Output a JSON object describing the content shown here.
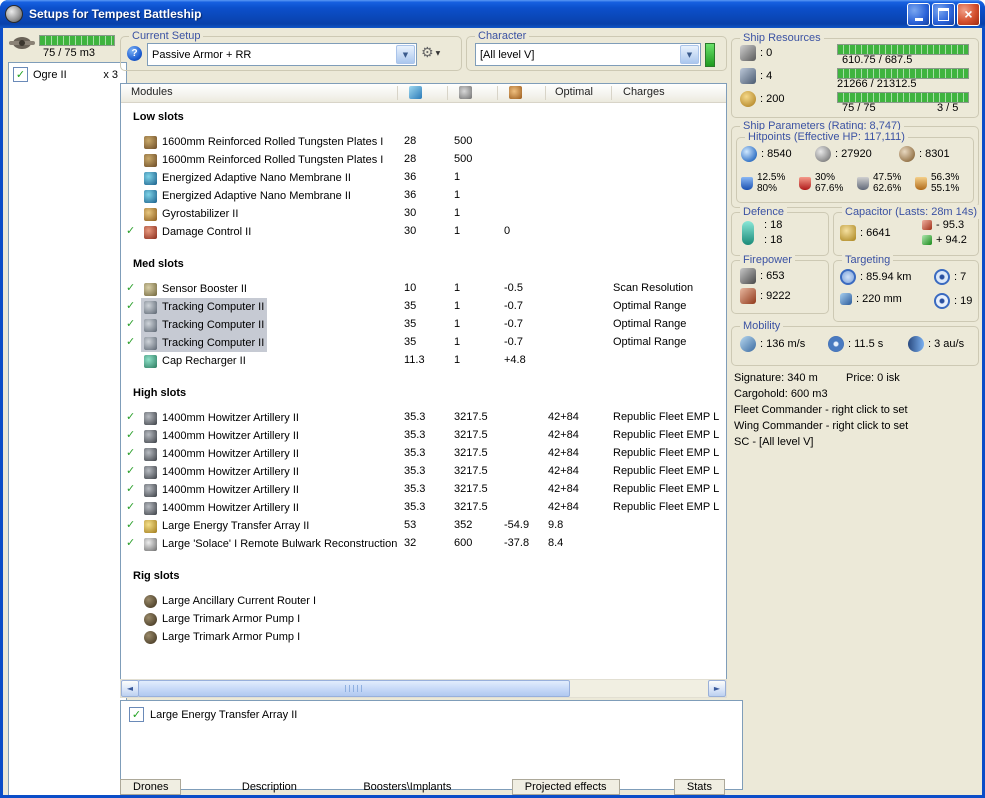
{
  "window": {
    "title": "Setups for Tempest Battleship"
  },
  "left_panel": {
    "drone_bay_capacity": "75 / 75 m3",
    "drones": [
      {
        "checked": true,
        "name": "Ogre II",
        "qty": "x 3"
      }
    ]
  },
  "setup_bar": {
    "current_setup_label": "Current Setup",
    "current_setup_value": "Passive Armor + RR",
    "character_label": "Character",
    "character_value": "[All level V]"
  },
  "modules": {
    "header": {
      "name": "Modules",
      "optimal": "Optimal",
      "charges": "Charges",
      "icons": [
        "cpu-icon",
        "powergrid-icon",
        "capacitor-icon"
      ]
    },
    "sections": [
      {
        "name": "Low slots",
        "rows": [
          {
            "active": false,
            "selected": false,
            "icon": "armor-plate-icon",
            "name": "1600mm Reinforced Rolled Tungsten Plates I",
            "cpu": "28",
            "pg": "500",
            "cap": "",
            "optimal": "",
            "charges": ""
          },
          {
            "active": false,
            "selected": false,
            "icon": "armor-plate-icon",
            "name": "1600mm Reinforced Rolled Tungsten Plates I",
            "cpu": "28",
            "pg": "500",
            "cap": "",
            "optimal": "",
            "charges": ""
          },
          {
            "active": false,
            "selected": false,
            "icon": "nano-membrane-icon",
            "name": "Energized Adaptive Nano Membrane II",
            "cpu": "36",
            "pg": "1",
            "cap": "",
            "optimal": "",
            "charges": ""
          },
          {
            "active": false,
            "selected": false,
            "icon": "nano-membrane-icon",
            "name": "Energized Adaptive Nano Membrane II",
            "cpu": "36",
            "pg": "1",
            "cap": "",
            "optimal": "",
            "charges": ""
          },
          {
            "active": false,
            "selected": false,
            "icon": "gyrostabilizer-icon",
            "name": "Gyrostabilizer II",
            "cpu": "30",
            "pg": "1",
            "cap": "",
            "optimal": "",
            "charges": ""
          },
          {
            "active": true,
            "selected": false,
            "icon": "damage-control-icon",
            "name": "Damage Control II",
            "cpu": "30",
            "pg": "1",
            "cap": "0",
            "optimal": "",
            "charges": ""
          }
        ]
      },
      {
        "name": "Med slots",
        "rows": [
          {
            "active": true,
            "selected": false,
            "icon": "sensor-booster-icon",
            "name": "Sensor Booster II",
            "cpu": "10",
            "pg": "1",
            "cap": "-0.5",
            "optimal": "",
            "charges": "Scan Resolution"
          },
          {
            "active": true,
            "selected": true,
            "icon": "tracking-computer-icon",
            "name": "Tracking Computer II",
            "cpu": "35",
            "pg": "1",
            "cap": "-0.7",
            "optimal": "",
            "charges": "Optimal Range"
          },
          {
            "active": true,
            "selected": true,
            "icon": "tracking-computer-icon",
            "name": "Tracking Computer II",
            "cpu": "35",
            "pg": "1",
            "cap": "-0.7",
            "optimal": "",
            "charges": "Optimal Range"
          },
          {
            "active": true,
            "selected": true,
            "icon": "tracking-computer-icon",
            "name": "Tracking Computer II",
            "cpu": "35",
            "pg": "1",
            "cap": "-0.7",
            "optimal": "",
            "charges": "Optimal Range"
          },
          {
            "active": false,
            "selected": false,
            "icon": "cap-recharger-icon",
            "name": "Cap Recharger II",
            "cpu": "11.3",
            "pg": "1",
            "cap": "+4.8",
            "optimal": "",
            "charges": ""
          }
        ]
      },
      {
        "name": "High slots",
        "rows": [
          {
            "active": true,
            "selected": false,
            "icon": "artillery-icon",
            "name": "1400mm Howitzer Artillery II",
            "cpu": "35.3",
            "pg": "3217.5",
            "cap": "",
            "optimal": "42+84",
            "charges": "Republic Fleet EMP L"
          },
          {
            "active": true,
            "selected": false,
            "icon": "artillery-icon",
            "name": "1400mm Howitzer Artillery II",
            "cpu": "35.3",
            "pg": "3217.5",
            "cap": "",
            "optimal": "42+84",
            "charges": "Republic Fleet EMP L"
          },
          {
            "active": true,
            "selected": false,
            "icon": "artillery-icon",
            "name": "1400mm Howitzer Artillery II",
            "cpu": "35.3",
            "pg": "3217.5",
            "cap": "",
            "optimal": "42+84",
            "charges": "Republic Fleet EMP L"
          },
          {
            "active": true,
            "selected": false,
            "icon": "artillery-icon",
            "name": "1400mm Howitzer Artillery II",
            "cpu": "35.3",
            "pg": "3217.5",
            "cap": "",
            "optimal": "42+84",
            "charges": "Republic Fleet EMP L"
          },
          {
            "active": true,
            "selected": false,
            "icon": "artillery-icon",
            "name": "1400mm Howitzer Artillery II",
            "cpu": "35.3",
            "pg": "3217.5",
            "cap": "",
            "optimal": "42+84",
            "charges": "Republic Fleet EMP L"
          },
          {
            "active": true,
            "selected": false,
            "icon": "artillery-icon",
            "name": "1400mm Howitzer Artillery II",
            "cpu": "35.3",
            "pg": "3217.5",
            "cap": "",
            "optimal": "42+84",
            "charges": "Republic Fleet EMP L"
          },
          {
            "active": true,
            "selected": false,
            "icon": "energy-transfer-icon",
            "name": "Large Energy Transfer Array II",
            "cpu": "53",
            "pg": "352",
            "cap": "-54.9",
            "optimal": "9.8",
            "charges": ""
          },
          {
            "active": true,
            "selected": false,
            "icon": "remote-repairer-icon",
            "name": "Large 'Solace' I Remote Bulwark Reconstruction",
            "cpu": "32",
            "pg": "600",
            "cap": "-37.8",
            "optimal": "8.4",
            "charges": ""
          }
        ]
      },
      {
        "name": "Rig slots",
        "rows": [
          {
            "active": false,
            "selected": false,
            "icon": "rig-icon",
            "name": "Large Ancillary Current Router I",
            "cpu": "",
            "pg": "",
            "cap": "",
            "optimal": "",
            "charges": ""
          },
          {
            "active": false,
            "selected": false,
            "icon": "rig-icon",
            "name": "Large Trimark Armor Pump I",
            "cpu": "",
            "pg": "",
            "cap": "",
            "optimal": "",
            "charges": ""
          },
          {
            "active": false,
            "selected": false,
            "icon": "rig-icon",
            "name": "Large Trimark Armor Pump I",
            "cpu": "",
            "pg": "",
            "cap": "",
            "optimal": "",
            "charges": ""
          }
        ]
      }
    ]
  },
  "charges_panel": {
    "items": [
      {
        "checked": true,
        "name": "Large Energy Transfer Array II"
      }
    ]
  },
  "bottom_tabs": [
    {
      "label": "Drones"
    },
    {
      "label": "Description"
    },
    {
      "label": "Boosters\\Implants"
    },
    {
      "label": "Projected effects"
    },
    {
      "label": "Stats"
    }
  ],
  "ship_resources": {
    "title": "Ship Resources",
    "turrets": ": 0",
    "launchers": ": 4",
    "calibration": ": 200",
    "cpu_usage": "610.75 / 687.5",
    "powergrid_usage": "21266 / 21312.5",
    "dronebay_usage": "75 / 75",
    "drones_active": "3 / 5"
  },
  "ship_parameters": {
    "title": "Ship Parameters (Rating: 8,747)",
    "hitpoints_title": "Hitpoints (Effective HP: 117,111)",
    "shield_hp": ": 8540",
    "armor_hp": ": 27920",
    "structure_hp": ": 8301",
    "resists": [
      {
        "icon": "em-resist-icon",
        "shield": "12.5%",
        "armor": "80%"
      },
      {
        "icon": "thermal-resist-icon",
        "shield": "30%",
        "armor": "67.6%"
      },
      {
        "icon": "kinetic-resist-icon",
        "shield": "47.5%",
        "armor": "62.6%"
      },
      {
        "icon": "explosive-resist-icon",
        "shield": "56.3%",
        "armor": "55.1%"
      }
    ]
  },
  "defence": {
    "title": "Defence",
    "value1": ": 18",
    "value2": ": 18"
  },
  "capacitor": {
    "title": "Capacitor (Lasts: 28m 14s)",
    "amount": ": 6641",
    "drain": "- 95.3",
    "recharge": "+ 94.2"
  },
  "firepower": {
    "title": "Firepower",
    "dps": ": 653",
    "volley": ": 9222"
  },
  "targeting": {
    "title": "Targeting",
    "range": ": 85.94 km",
    "max_targets": ": 7",
    "scan_resolution": ": 220 mm",
    "sensor_strength": ": 19"
  },
  "mobility": {
    "title": "Mobility",
    "speed": ": 136 m/s",
    "align_time": ": 11.5 s",
    "warp_speed": ": 3 au/s"
  },
  "info": {
    "signature": "Signature: 340 m",
    "price": "Price: 0 isk",
    "cargohold": "Cargohold: 600 m3",
    "fleet_commander": "Fleet Commander - right click to set",
    "wing_commander": "Wing Commander - right click to set",
    "sc": "SC - [All level V]"
  },
  "colors": {
    "titlebar_blue": "#0b4dc8",
    "group_title_blue": "#3b52a3",
    "bar_green": "#3fb43f",
    "check_green": "#2ca02c",
    "close_red": "#d4502e",
    "selection_gray": "#c6cad3",
    "client_bg": "#ece9d8"
  }
}
